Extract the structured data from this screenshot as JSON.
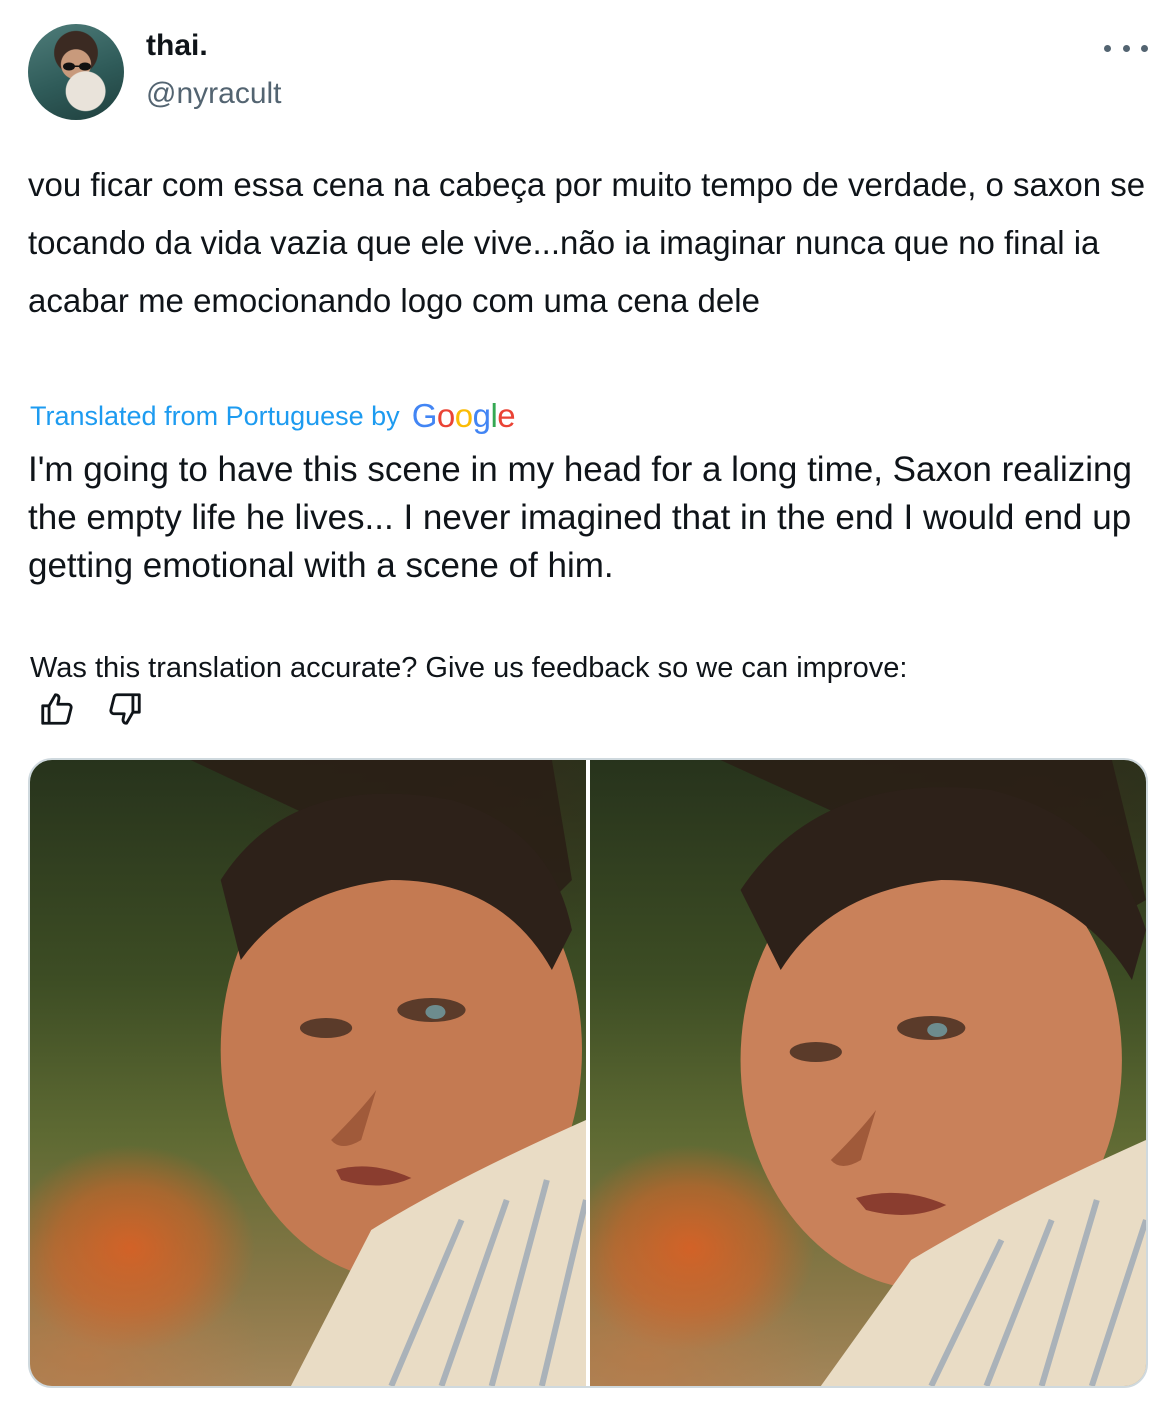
{
  "author": {
    "name": "thai.",
    "handle": "@nyracult"
  },
  "tweet": {
    "original_text": "vou ficar com essa cena na cabeça por muito tempo de verdade, o saxon se tocando da vida vazia que ele vive...não ia imaginar nunca que no final ia acabar me emocionando logo com uma cena dele",
    "translated_label": "Translated from Portuguese by",
    "translator_brand": "Google",
    "translation_text": "I'm going to have this scene in my head for a long time, Saxon realizing the empty life he lives... I never imagined that in the end I would end up getting emotional with a scene of him.",
    "feedback_prompt": "Was this translation accurate? Give us feedback so we can improve:"
  },
  "icons": {
    "more": "more-dots-icon",
    "thumbs_up": "thumbs-up-icon",
    "thumbs_down": "thumbs-down-icon"
  },
  "colors": {
    "link": "#1d9bf0",
    "text": "#0f1419",
    "secondary": "#536471",
    "border": "#cfd9de"
  }
}
